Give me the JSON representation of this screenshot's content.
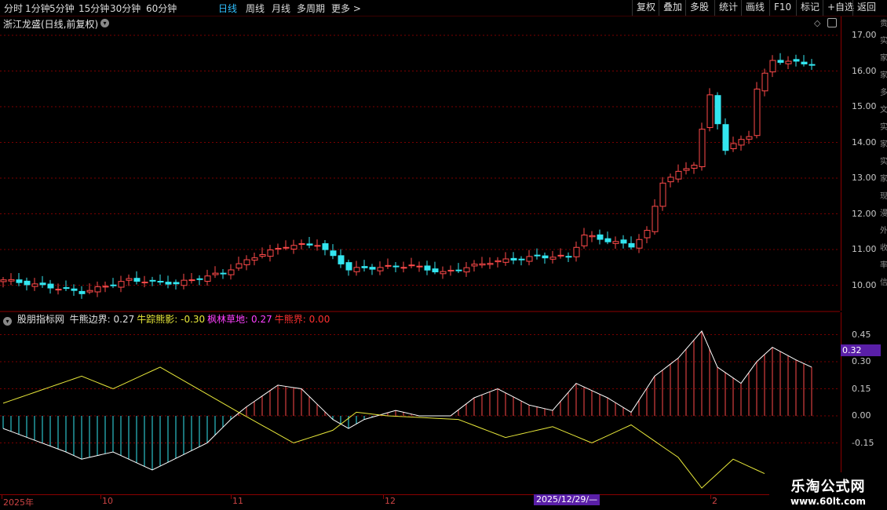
{
  "toolbar": {
    "periods": [
      "分时",
      "1分钟",
      "5分钟",
      "15分钟",
      "30分钟",
      "60分钟",
      "日线",
      "周线",
      "月线",
      "多周期",
      "更多"
    ],
    "active_period": "日线",
    "right_buttons": [
      "复权",
      "叠加",
      "多股",
      "统计",
      "画线",
      "F10",
      "标记",
      "+自选",
      "返回"
    ]
  },
  "stock_title": "浙江龙盛(日线,前复权)",
  "price_axis": [
    "17.00",
    "16.00",
    "15.00",
    "14.00",
    "13.00",
    "12.00",
    "11.00",
    "10.00"
  ],
  "indicator": {
    "name": "股朋指标网",
    "items": [
      {
        "label": "牛熊边界:",
        "value": "0.27",
        "color": "#e0e0e0"
      },
      {
        "label": "牛踪熊影:",
        "value": "-0.30",
        "color": "#e8e83a"
      },
      {
        "label": "枫林草地:",
        "value": "0.27",
        "color": "#ff40ff"
      },
      {
        "label": "牛熊界:",
        "value": "0.00",
        "color": "#ff3030"
      }
    ],
    "axis": [
      "0.45",
      "0.30",
      "0.15",
      "0.00",
      "-0.15"
    ],
    "current_badge": "0.32"
  },
  "date_axis": [
    "2025年",
    "10",
    "11",
    "12",
    "2"
  ],
  "date_highlight": "2025/12/29/—",
  "right_strip_chars": [
    "贵",
    "实",
    "家",
    "家",
    "多",
    "文",
    "实",
    "家",
    "实",
    "家",
    "现",
    "漫",
    "外",
    "收",
    "率",
    "信"
  ],
  "watermark": {
    "title": "乐淘公式网",
    "url": "www.60lt.com"
  },
  "colors": {
    "up": "#ff4a4a",
    "down": "#33e6f0",
    "signal": "#e8e83a",
    "line": "#ffffff",
    "grid": "#7a0000"
  }
}
